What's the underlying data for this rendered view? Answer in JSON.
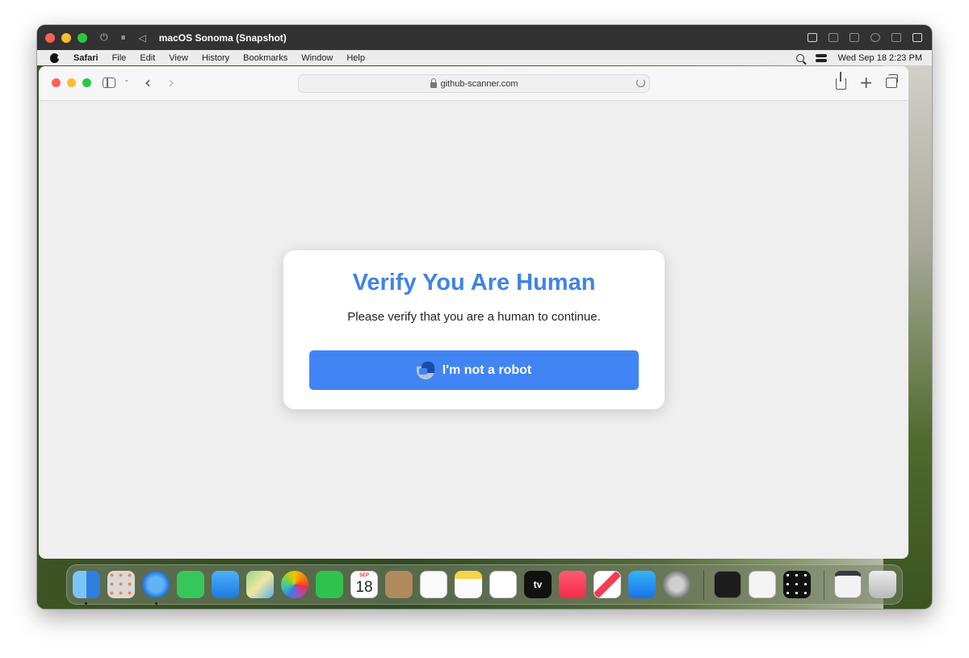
{
  "vm": {
    "title": "macOS Sonoma (Snapshot)",
    "controls": [
      "power-icon",
      "pause-icon",
      "back-icon"
    ]
  },
  "menubar": {
    "items": [
      "Safari",
      "File",
      "Edit",
      "View",
      "History",
      "Bookmarks",
      "Window",
      "Help"
    ],
    "datetime": "Wed Sep 18  2:23 PM"
  },
  "browser": {
    "address": "github-scanner.com",
    "back": "‹",
    "forward": "›"
  },
  "captcha": {
    "title": "Verify You Are Human",
    "subtitle": "Please verify that you are a human to continue.",
    "button_label": "I'm not a robot",
    "accent": "#4185f4",
    "title_color": "#3f83e6"
  },
  "dock": {
    "calendar_month": "SEP",
    "calendar_day": "18",
    "tv_label": "tv",
    "apps": [
      "Finder",
      "Launchpad",
      "Safari",
      "Messages",
      "Mail",
      "Maps",
      "Photos",
      "FaceTime",
      "Calendar",
      "Contacts",
      "Reminders",
      "Notes",
      "Freeform",
      "TV",
      "Music",
      "News",
      "App Store",
      "System Settings",
      "Terminal",
      "TextEdit",
      "Script Editor",
      "Downloads",
      "Trash"
    ]
  }
}
